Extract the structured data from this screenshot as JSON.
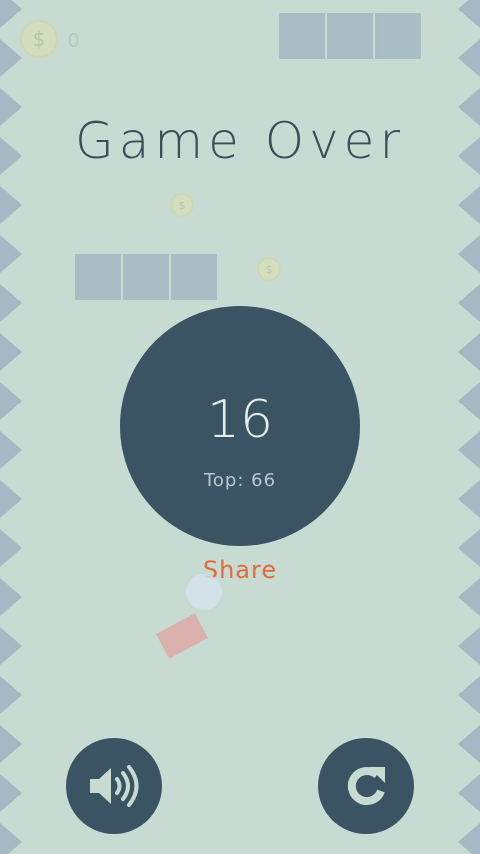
{
  "colors": {
    "background": "#c8dbd3",
    "spike": "#a5b8c3",
    "dark": "#3a5463",
    "accent": "#e2683d"
  },
  "hud": {
    "coin_icon_glyph": "$",
    "coin_count": "0"
  },
  "title": "Game Over",
  "result": {
    "score": "16",
    "top_label": "Top: 66"
  },
  "share_label": "Share",
  "background_coins": [
    "$",
    "$"
  ],
  "controls": {
    "sound_icon": "speaker-volume-icon",
    "restart_icon": "restart-arrow-icon"
  }
}
